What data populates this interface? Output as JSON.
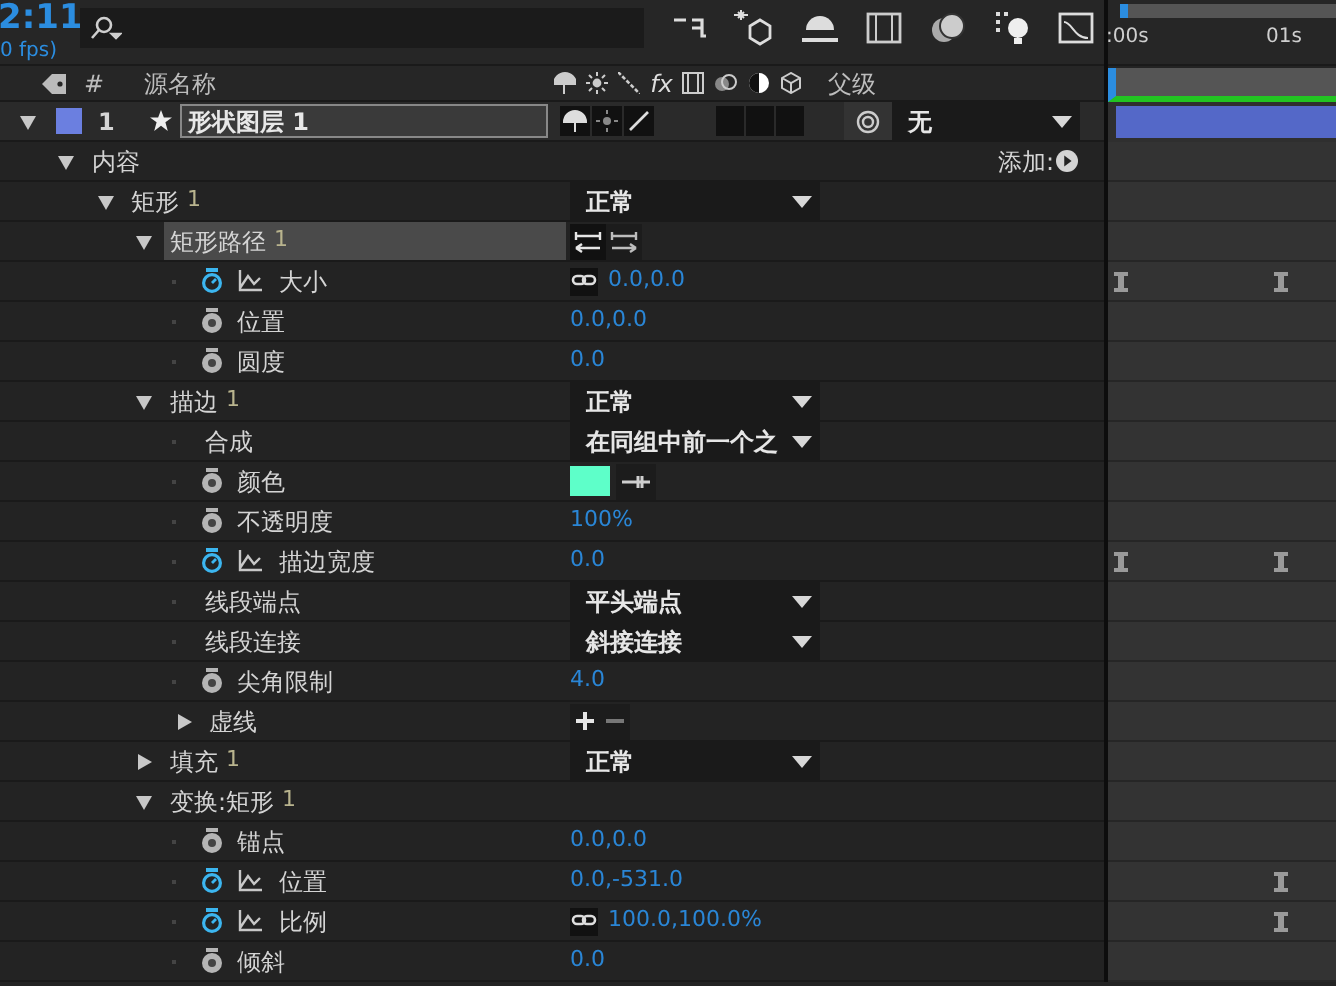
{
  "header": {
    "time": "2:11",
    "fps": "0 fps)"
  },
  "ruler": {
    "labels": [
      ":00s",
      "01s"
    ]
  },
  "columns": {
    "number": "#",
    "source_name": "源名称",
    "fx": "fx",
    "parent": "父级"
  },
  "layer": {
    "expanded": true,
    "color": "#6b7fe0",
    "index": "1",
    "name": "形状图层 1",
    "parent": "无"
  },
  "properties": [
    {
      "kind": "group",
      "name": "内容",
      "expanded": true,
      "selected": false,
      "action": "添加:",
      "children": [
        {
          "kind": "group",
          "name": "矩形",
          "number": "1",
          "expanded": true,
          "selected": false,
          "dropdown": "正常",
          "children": [
            {
              "kind": "group",
              "name": "矩形路径",
              "number": "1",
              "expanded": true,
              "selected": true,
              "direction_buttons": true,
              "children": [
                {
                  "kind": "property",
                  "name": "大小",
                  "animated": true,
                  "graph": true,
                  "linked": true,
                  "value": "0.0,0.0",
                  "keyframe_at_start": true,
                  "keyframe_at_end": true
                },
                {
                  "kind": "property",
                  "name": "位置",
                  "animated": false,
                  "graph": false,
                  "value": "0.0,0.0"
                },
                {
                  "kind": "property",
                  "name": "圆度",
                  "animated": false,
                  "graph": false,
                  "value": "0.0"
                }
              ]
            },
            {
              "kind": "group",
              "name": "描边",
              "number": "1",
              "expanded": true,
              "selected": false,
              "dropdown": "正常",
              "children": [
                {
                  "kind": "option",
                  "name": "合成",
                  "dropdown": "在同组中前一个之"
                },
                {
                  "kind": "property",
                  "name": "颜色",
                  "animated": false,
                  "graph": false,
                  "color": "#5effc9"
                },
                {
                  "kind": "property",
                  "name": "不透明度",
                  "animated": false,
                  "graph": false,
                  "value": "100%"
                },
                {
                  "kind": "property",
                  "name": "描边宽度",
                  "animated": true,
                  "graph": true,
                  "value": "0.0",
                  "keyframe_at_start": true,
                  "keyframe_at_end": true
                },
                {
                  "kind": "option",
                  "name": "线段端点",
                  "dropdown": "平头端点"
                },
                {
                  "kind": "option",
                  "name": "线段连接",
                  "dropdown": "斜接连接"
                },
                {
                  "kind": "property",
                  "name": "尖角限制",
                  "animated": false,
                  "graph": false,
                  "value": "4.0"
                },
                {
                  "kind": "group",
                  "name": "虚线",
                  "expanded": false,
                  "selected": false,
                  "add_remove": true
                }
              ]
            },
            {
              "kind": "group",
              "name": "填充",
              "number": "1",
              "expanded": false,
              "selected": false,
              "dropdown": "正常"
            },
            {
              "kind": "group",
              "name": "变换:矩形",
              "number": "1",
              "expanded": true,
              "selected": false,
              "children": [
                {
                  "kind": "property",
                  "name": "锚点",
                  "animated": false,
                  "graph": false,
                  "value": "0.0,0.0"
                },
                {
                  "kind": "property",
                  "name": "位置",
                  "animated": true,
                  "graph": true,
                  "value": "0.0,-531.0",
                  "keyframe_at_start": false,
                  "keyframe_at_end": true
                },
                {
                  "kind": "property",
                  "name": "比例",
                  "animated": true,
                  "graph": true,
                  "linked": true,
                  "value": "100.0,100.0%",
                  "keyframe_at_start": false,
                  "keyframe_at_end": true
                },
                {
                  "kind": "property",
                  "name": "倾斜",
                  "animated": false,
                  "graph": false,
                  "value": "0.0"
                }
              ]
            }
          ]
        }
      ]
    }
  ]
}
